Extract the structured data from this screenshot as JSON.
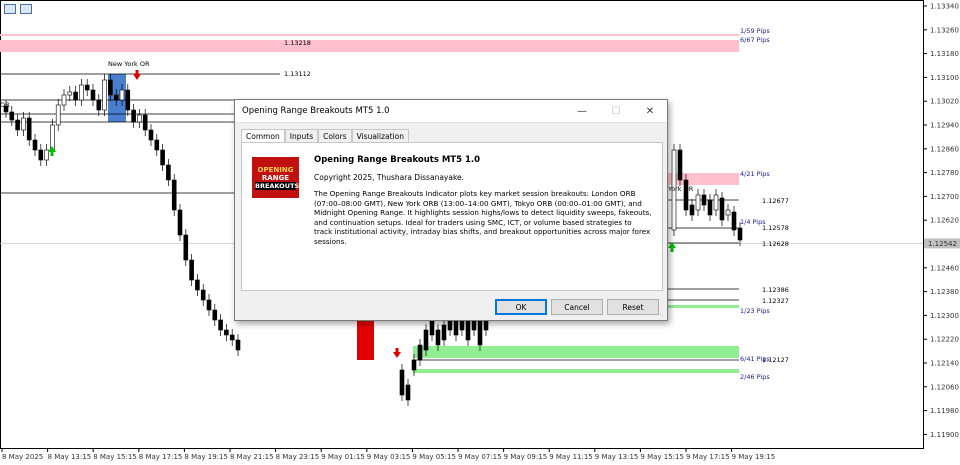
{
  "chart": {
    "price_scale": [
      "1.13340",
      "1.13260",
      "1.13180",
      "1.13100",
      "1.13020",
      "1.12940",
      "1.12860",
      "1.12780",
      "1.12700",
      "1.12620",
      "1.12540",
      "1.12460",
      "1.12380",
      "1.12300",
      "1.12220",
      "1.12140",
      "1.12060",
      "1.11980",
      "1.11900"
    ],
    "current_price": "1.12542",
    "time_scale": [
      "8 May 2025",
      "8 May 13:15",
      "8 May 15:15",
      "8 May 17:15",
      "8 May 19:15",
      "8 May 21:15",
      "8 May 23:15",
      "9 May 01:15",
      "9 May 03:15",
      "9 May 05:15",
      "9 May 07:15",
      "9 May 09:15",
      "9 May 11:15",
      "9 May 13:15",
      "9 May 15:15",
      "9 May 17:15",
      "9 May 19:15"
    ],
    "level_labels": [
      "1.13218",
      "1.13112",
      "1.12677",
      "1.12578",
      "1.12628",
      "1.12386",
      "1.12327",
      "1.12127"
    ],
    "session_labels": [
      "New York OR",
      "OR",
      "York OR"
    ],
    "pip_labels": [
      "1/59 Pips",
      "6/67 Pips",
      "4/21 Pips",
      "1/4 Pips",
      "1/23 Pips",
      "6/41 Pips",
      "2/46 Pips"
    ],
    "colors": {
      "bear_zone": "#ffc0cb",
      "bull_zone": "#90ee90",
      "ny_box": "#4a7fd0",
      "red_box": "#e00000",
      "up_arrow": "#00c000",
      "down_arrow": "#e00000"
    }
  },
  "dialog": {
    "title": "Opening Range Breakouts MT5 1.0",
    "tabs": [
      "Common",
      "Inputs",
      "Colors",
      "Visualization"
    ],
    "active_tab": "Common",
    "logo_lines": [
      "OPENING",
      "RANGE",
      "BREAKOUTS"
    ],
    "product_title": "Opening Range Breakouts MT5 1.0",
    "copyright": "Copyright 2025, Thushara Dissanayake.",
    "description": "The Opening Range Breakouts Indicator plots key market session breakouts: London ORB (07:00–08:00 GMT), New York ORB (13:00–14:00 GMT), Tokyo ORB (00:00–01:00 GMT), and Midnight Opening Range. It highlights session highs/lows to detect liquidity sweeps, fakeouts, and continuation setups. Ideal for traders using SMC, ICT, or volume based strategies to track institutional activity, intraday bias shifts, and breakout opportunities across major forex sessions.",
    "buttons": {
      "ok": "OK",
      "cancel": "Cancel",
      "reset": "Reset"
    }
  }
}
